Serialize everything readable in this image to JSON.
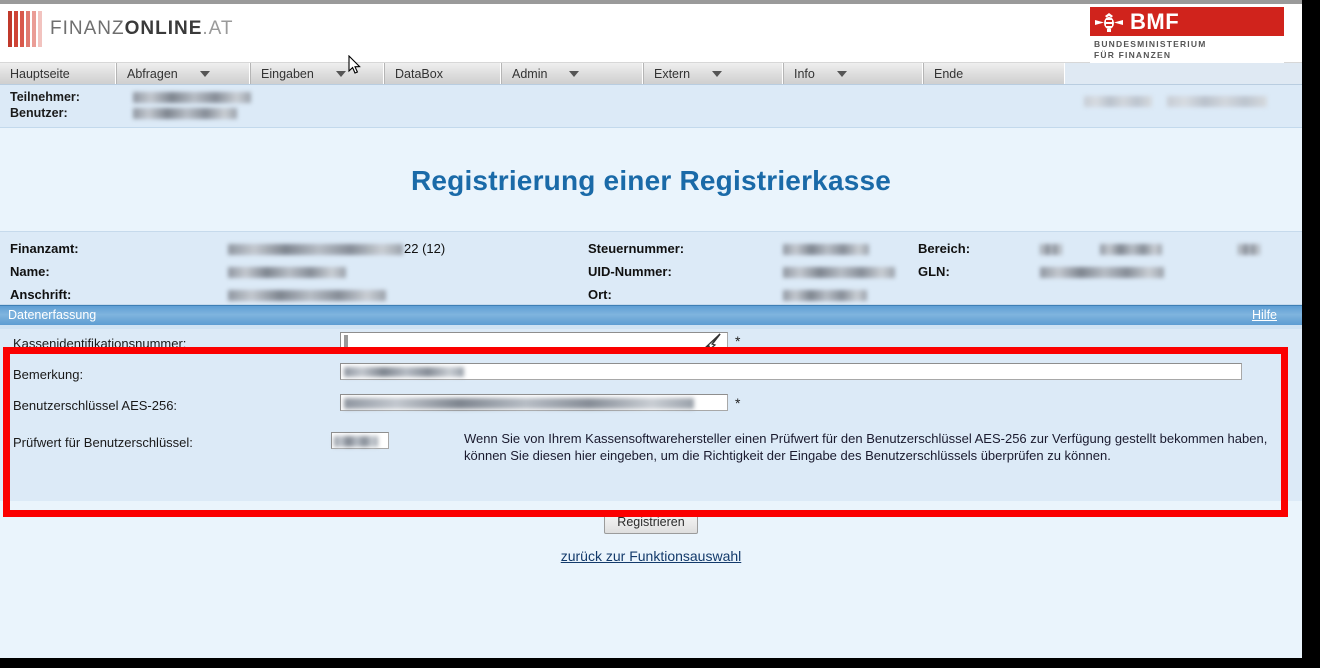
{
  "brand": {
    "logo_text_1": "FINANZ",
    "logo_text_2": "ONLINE",
    "logo_text_3": ".AT",
    "bmf_letters": "BMF",
    "bmf_subtitle_line1": "BUNDESMINISTERIUM",
    "bmf_subtitle_line2": "FÜR FINANZEN",
    "accent_red": "#d0231c",
    "accent_blue": "#1a6aa8",
    "annotation_red": "#fb0000"
  },
  "menu": {
    "items": [
      {
        "label": "Hauptseite",
        "has_caret": false
      },
      {
        "label": "Abfragen",
        "has_caret": true
      },
      {
        "label": "Eingaben",
        "has_caret": true
      },
      {
        "label": "DataBox",
        "has_caret": false
      },
      {
        "label": "Admin",
        "has_caret": true
      },
      {
        "label": "Extern",
        "has_caret": true
      },
      {
        "label": "Info",
        "has_caret": true
      },
      {
        "label": "Ende",
        "has_caret": false
      }
    ]
  },
  "userbar": {
    "participant_label": "Teilnehmer:",
    "user_label": "Benutzer:",
    "participant_value": "",
    "user_value": "",
    "date_value": ""
  },
  "page_title": "Registrierung einer Registrierkasse",
  "info": {
    "tax_office_label": "Finanzamt:",
    "tax_office_value": "22 (12)",
    "name_label": "Name:",
    "name_value": "",
    "address_label": "Anschrift:",
    "address_value": "",
    "tax_number_label": "Steuernummer:",
    "tax_number_value": "",
    "uid_label": "UID-Nummer:",
    "uid_value": "",
    "city_label": "Ort:",
    "city_value": "",
    "area_label": "Bereich:",
    "area_value": "",
    "gln_label": "GLN:",
    "gln_value": ""
  },
  "section": {
    "title": "Datenerfassung",
    "help_link": "Hilfe"
  },
  "form": {
    "cash_register_id_label": "Kassenidentifikationsnummer:",
    "cash_register_id_value": "",
    "cash_register_id_required": "*",
    "remark_label": "Bemerkung:",
    "remark_value": "",
    "aes_key_label": "Benutzerschlüssel AES-256:",
    "aes_key_value": "",
    "aes_key_required": "*",
    "check_value_label": "Prüfwert für Benutzerschlüssel:",
    "check_value_value": "",
    "help_text": "Wenn Sie von Ihrem Kassensoftwarehersteller einen Prüfwert für den Benutzerschlüssel AES-256 zur Verfügung gestellt bekommen haben, können Sie diesen hier eingeben, um die Richtigkeit der Eingabe des Benutzerschlüssels überprüfen zu können."
  },
  "actions": {
    "submit_label": "Registrieren",
    "back_link": "zurück zur Funktionsauswahl"
  }
}
